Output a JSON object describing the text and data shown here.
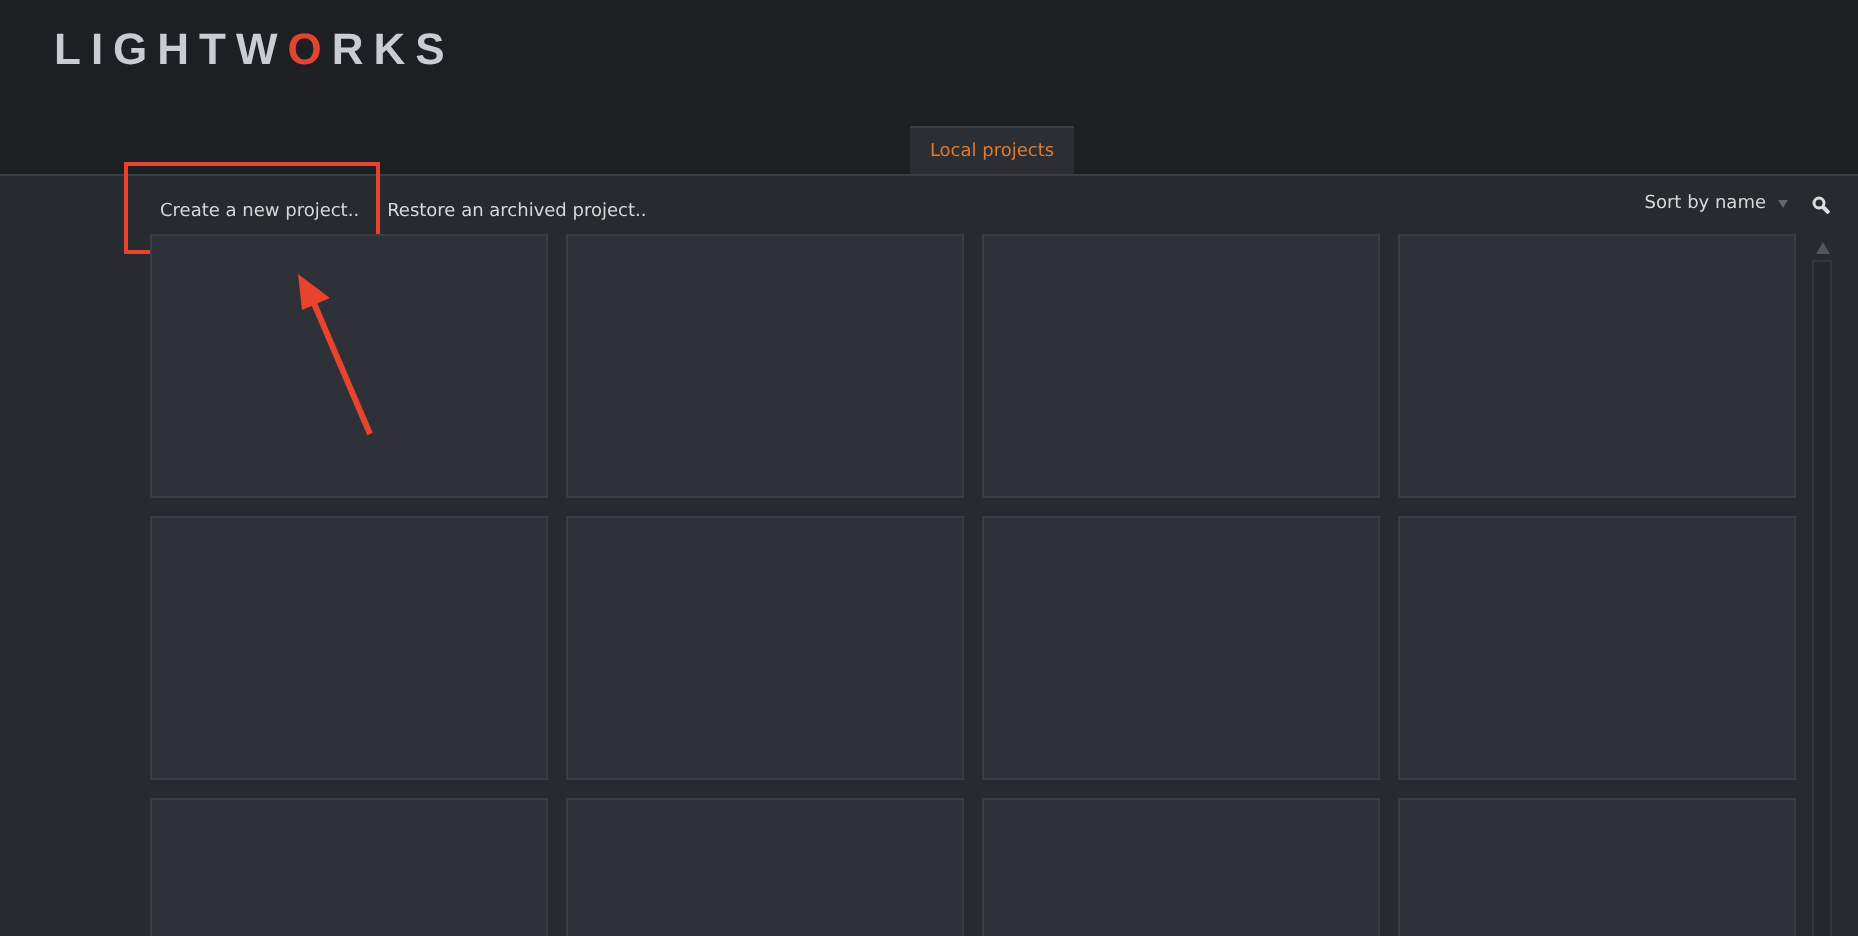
{
  "logo": {
    "parts": [
      {
        "text": "LIGHTW",
        "accent": false
      },
      {
        "text": "O",
        "accent": true
      },
      {
        "text": "RKS",
        "accent": false
      }
    ]
  },
  "tabs": [
    {
      "label": "Local projects",
      "selected": true
    }
  ],
  "actions": [
    {
      "label": "Create a new project..",
      "highlighted": true
    },
    {
      "label": "Restore an archived project..",
      "highlighted": false
    }
  ],
  "sort": {
    "label": "Sort by name"
  },
  "tiles": [
    {
      "kind": "empty"
    },
    {
      "kind": "empty"
    },
    {
      "kind": "empty"
    },
    {
      "kind": "empty"
    },
    {
      "kind": "empty"
    },
    {
      "kind": "empty"
    },
    {
      "kind": "empty"
    },
    {
      "kind": "empty"
    },
    {
      "kind": "empty"
    },
    {
      "kind": "empty"
    },
    {
      "kind": "empty"
    },
    {
      "kind": "empty"
    }
  ]
}
